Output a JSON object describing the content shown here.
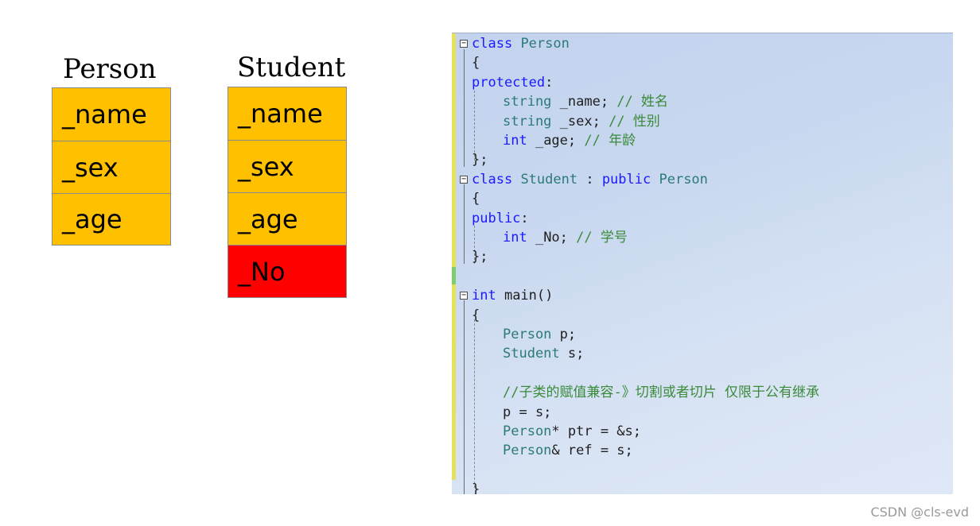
{
  "diagram": {
    "person": {
      "title": "Person",
      "fields": [
        "_name",
        "_sex",
        "_age"
      ]
    },
    "student": {
      "title": "Student",
      "fields": [
        "_name",
        "_sex",
        "_age",
        "_No"
      ]
    },
    "colors": {
      "inherited": "#ffc000",
      "own": "#ff0000"
    }
  },
  "code": {
    "lines": [
      {
        "indent": 0,
        "fold": true,
        "tokens": [
          [
            "kw",
            "class"
          ],
          [
            "pl",
            " "
          ],
          [
            "ty",
            "Person"
          ]
        ]
      },
      {
        "indent": 0,
        "fold": false,
        "tokens": [
          [
            "pl",
            "{"
          ]
        ]
      },
      {
        "indent": 0,
        "fold": false,
        "tokens": [
          [
            "kw",
            "protected"
          ],
          [
            "pl",
            ":"
          ]
        ]
      },
      {
        "indent": 1,
        "fold": false,
        "tokens": [
          [
            "ty",
            "string"
          ],
          [
            "pl",
            " _name; "
          ],
          [
            "cm",
            "// 姓名"
          ]
        ]
      },
      {
        "indent": 1,
        "fold": false,
        "tokens": [
          [
            "ty",
            "string"
          ],
          [
            "pl",
            " _sex; "
          ],
          [
            "cm",
            "// 性别"
          ]
        ]
      },
      {
        "indent": 1,
        "fold": false,
        "tokens": [
          [
            "kw",
            "int"
          ],
          [
            "pl",
            " _age; "
          ],
          [
            "cm",
            "// 年龄"
          ]
        ]
      },
      {
        "indent": 0,
        "fold": false,
        "tokens": [
          [
            "pl",
            "};"
          ]
        ]
      },
      {
        "indent": 0,
        "fold": true,
        "tokens": [
          [
            "kw",
            "class"
          ],
          [
            "pl",
            " "
          ],
          [
            "ty",
            "Student"
          ],
          [
            "pl",
            " : "
          ],
          [
            "kw",
            "public"
          ],
          [
            "pl",
            " "
          ],
          [
            "ty",
            "Person"
          ]
        ]
      },
      {
        "indent": 0,
        "fold": false,
        "tokens": [
          [
            "pl",
            "{"
          ]
        ]
      },
      {
        "indent": 0,
        "fold": false,
        "tokens": [
          [
            "kw",
            "public"
          ],
          [
            "pl",
            ":"
          ]
        ]
      },
      {
        "indent": 1,
        "fold": false,
        "tokens": [
          [
            "kw",
            "int"
          ],
          [
            "pl",
            " _No; "
          ],
          [
            "cm",
            "// 学号"
          ]
        ]
      },
      {
        "indent": 0,
        "fold": false,
        "tokens": [
          [
            "pl",
            "};"
          ]
        ]
      },
      {
        "indent": 0,
        "fold": false,
        "tokens": []
      },
      {
        "indent": 0,
        "fold": true,
        "tokens": [
          [
            "kw",
            "int"
          ],
          [
            "pl",
            " main()"
          ]
        ]
      },
      {
        "indent": 0,
        "fold": false,
        "tokens": [
          [
            "pl",
            "{"
          ]
        ]
      },
      {
        "indent": 1,
        "fold": false,
        "tokens": [
          [
            "ty",
            "Person"
          ],
          [
            "pl",
            " p;"
          ]
        ]
      },
      {
        "indent": 1,
        "fold": false,
        "tokens": [
          [
            "ty",
            "Student"
          ],
          [
            "pl",
            " s;"
          ]
        ]
      },
      {
        "indent": 0,
        "fold": false,
        "tokens": []
      },
      {
        "indent": 1,
        "fold": false,
        "tokens": [
          [
            "cm",
            "//子类的赋值兼容-》切割或者切片 仅限于公有继承"
          ]
        ]
      },
      {
        "indent": 1,
        "fold": false,
        "tokens": [
          [
            "pl",
            "p = s;"
          ]
        ]
      },
      {
        "indent": 1,
        "fold": false,
        "tokens": [
          [
            "ty",
            "Person"
          ],
          [
            "pl",
            "* ptr = &s;"
          ]
        ]
      },
      {
        "indent": 1,
        "fold": false,
        "tokens": [
          [
            "ty",
            "Person"
          ],
          [
            "pl",
            "& ref = s;"
          ]
        ]
      },
      {
        "indent": 0,
        "fold": false,
        "tokens": []
      },
      {
        "indent": 0,
        "fold": false,
        "tokens": [
          [
            "pl",
            "}"
          ]
        ]
      }
    ]
  },
  "watermark": "CSDN @cls-evd"
}
